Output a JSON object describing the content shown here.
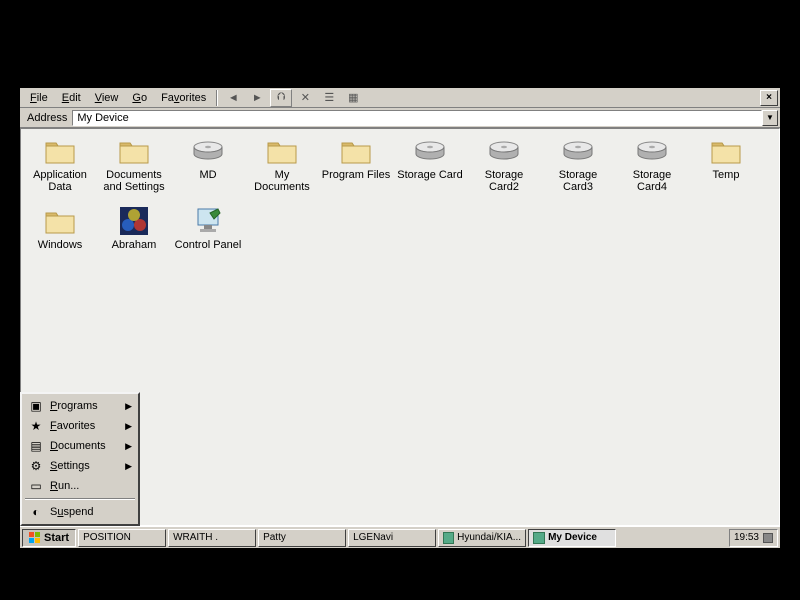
{
  "menubar": {
    "items": [
      {
        "label": "File",
        "u": 0
      },
      {
        "label": "Edit",
        "u": 0
      },
      {
        "label": "View",
        "u": 0
      },
      {
        "label": "Go",
        "u": 0
      },
      {
        "label": "Favorites",
        "u": 2
      }
    ]
  },
  "toolbar_buttons": [
    "back",
    "forward",
    "up",
    "delete",
    "properties",
    "views"
  ],
  "close_label": "×",
  "address": {
    "label": "Address",
    "value": "My Device"
  },
  "items": [
    {
      "type": "folder",
      "label": "Application Data"
    },
    {
      "type": "folder",
      "label": "Documents and Settings"
    },
    {
      "type": "drive",
      "label": "MD"
    },
    {
      "type": "folder",
      "label": "My Documents"
    },
    {
      "type": "folder",
      "label": "Program Files"
    },
    {
      "type": "drive",
      "label": "Storage Card"
    },
    {
      "type": "drive",
      "label": "Storage Card2"
    },
    {
      "type": "drive",
      "label": "Storage Card3"
    },
    {
      "type": "drive",
      "label": "Storage Card4"
    },
    {
      "type": "folder",
      "label": "Temp"
    },
    {
      "type": "folder",
      "label": "Windows"
    },
    {
      "type": "app",
      "label": "Abraham"
    },
    {
      "type": "cpl",
      "label": "Control Panel"
    }
  ],
  "startmenu": [
    {
      "icon": "programs",
      "label": "Programs",
      "arrow": true,
      "u": 0
    },
    {
      "icon": "favorites",
      "label": "Favorites",
      "arrow": true,
      "u": 0
    },
    {
      "icon": "documents",
      "label": "Documents",
      "arrow": true,
      "u": 0
    },
    {
      "icon": "settings",
      "label": "Settings",
      "arrow": true,
      "u": 0
    },
    {
      "icon": "run",
      "label": "Run...",
      "arrow": false,
      "u": 0
    },
    {
      "sep": true
    },
    {
      "icon": "suspend",
      "label": "Suspend",
      "arrow": false,
      "u": 1
    }
  ],
  "taskbar": {
    "start": "Start",
    "buttons": [
      {
        "label": "POSITION",
        "active": false
      },
      {
        "label": "WRAITH .",
        "active": false
      },
      {
        "label": "Patty",
        "active": false
      },
      {
        "label": "LGENavi",
        "active": false
      },
      {
        "label": "Hyundai/KIA...",
        "active": false,
        "icon": true
      },
      {
        "label": "My Device",
        "active": true,
        "icon": true
      }
    ],
    "clock": "19:53"
  },
  "colors": {
    "folder_light": "#f4e2a8",
    "folder_dark": "#d9b96b",
    "drive_top": "#e8e8e8",
    "drive_side": "#b0b0b0"
  }
}
